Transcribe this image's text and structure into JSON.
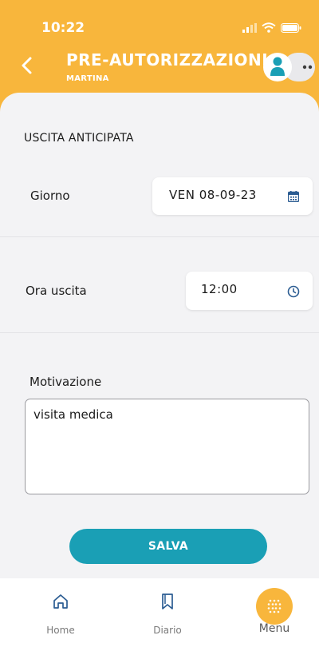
{
  "status_bar": {
    "time": "10:22"
  },
  "header": {
    "title": "PRE-AUTORIZZAZIONI",
    "subtitle": "MARTINA"
  },
  "form": {
    "section_title": "USCITA ANTICIPATA",
    "day_label": "Giorno",
    "day_value": "VEN 08-09-23",
    "time_label": "Ora uscita",
    "time_value": "12:00",
    "reason_label": "Motivazione",
    "reason_value": "visita medica",
    "save_label": "SALVA"
  },
  "tabbar": {
    "items": [
      {
        "label": "Home",
        "icon": "home-icon"
      },
      {
        "label": "Diario",
        "icon": "bookmark-icon"
      },
      {
        "label": "Menu",
        "icon": "menu-dots-icon",
        "active": true
      }
    ]
  },
  "colors": {
    "brand": "#f8b63c",
    "accent": "#1a9fb5",
    "icon_blue": "#2b5c92",
    "sheet_bg": "#f3f3f5"
  }
}
